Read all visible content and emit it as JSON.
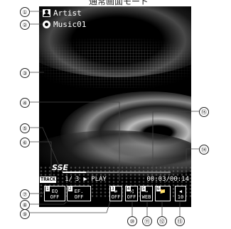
{
  "title": "通常画面モード",
  "artist": "Artist",
  "music": "Music01",
  "surround_logo": "SSE",
  "track": {
    "badge": "TRACK",
    "current": "1/",
    "total": "3",
    "state": "▶ PLAY",
    "elapsed": "00:03",
    "duration": "00:14"
  },
  "progress_fraction": 0.22,
  "controls": [
    {
      "num": "1",
      "top": "EQ",
      "bottom": "OFF"
    },
    {
      "num": "2",
      "top": "EF.",
      "bottom": "OFF"
    },
    {
      "num": "3",
      "top": "⇄",
      "bottom": "OFF"
    },
    {
      "num": "4",
      "top": "⤨",
      "bottom": "OFF"
    },
    {
      "num": "5",
      "top": "→",
      "bottom": "WEB"
    },
    {
      "num": "6",
      "top": "📁",
      "bottom": ""
    },
    {
      "num": "",
      "top": "◀",
      "bottom": "10"
    }
  ],
  "callouts": [
    "①",
    "②",
    "③",
    "④",
    "⑤",
    "⑥",
    "⑦",
    "⑧",
    "⑨",
    "⑩",
    "⑪",
    "⑫",
    "⑬",
    "⑭",
    "⑮"
  ]
}
